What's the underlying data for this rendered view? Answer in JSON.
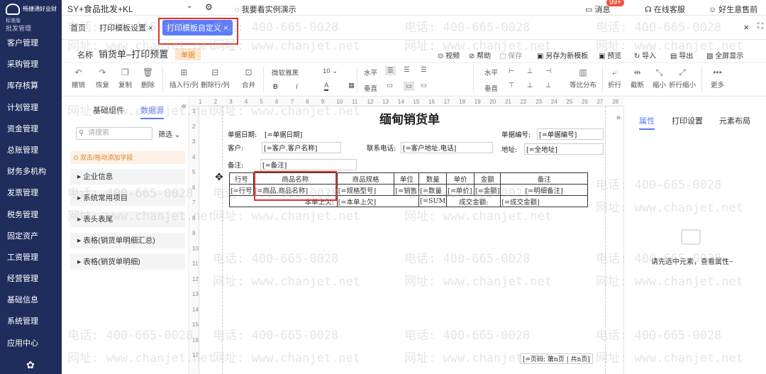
{
  "app": {
    "logo_text": "畅捷通好业财",
    "edition": "标准版",
    "module": "批发管理",
    "company": "SY+食品批发+KL",
    "demo_link": "我要看实例演示",
    "messages_label": "消息",
    "messages_count": "99+",
    "service_label": "在线客服",
    "user_label": "好生意售前"
  },
  "sidebar": {
    "items": [
      "客户管理",
      "采购管理",
      "库存核算",
      "计划管理",
      "资金管理",
      "总账管理",
      "财务多机构",
      "发票管理",
      "税务管理",
      "固定资产",
      "工资管理",
      "经营管理",
      "基础信息",
      "系统管理",
      "应用中心"
    ]
  },
  "tabs": [
    {
      "label": "首页"
    },
    {
      "label": "打印模板设置"
    },
    {
      "label": "打印模板自定义"
    }
  ],
  "template": {
    "name_label": "名称",
    "name": "销货单–打印预置",
    "tag": "单据",
    "actions": [
      "视频",
      "帮助",
      "保存",
      "另存为新模板",
      "预览",
      "导入",
      "导出",
      "全屏显示"
    ]
  },
  "toolbar": {
    "undo": "撤销",
    "redo": "恢复",
    "copy": "复制",
    "delete": "删除",
    "insert_row": "插入行/列",
    "delete_row": "删除行/列",
    "merge": "合并",
    "font": "微软雅黑",
    "size": "10",
    "h_align": "水平",
    "v_align": "垂直",
    "h_align2": "水平",
    "v_align2": "垂直",
    "dist": "等比分布",
    "wrap": "折行",
    "cut": "截断",
    "shrink": "缩小",
    "wrap_shrink": "折行缩小",
    "more": "更多"
  },
  "left_panel": {
    "tab_basic": "基础组件",
    "tab_data": "数据源",
    "search_placeholder": "请搜索",
    "filter": "筛选",
    "hint": "双击/拖动添加字段",
    "groups": [
      "企业信息",
      "系统常用项目",
      "表头表尾",
      "表格(销货单明细汇总)",
      "表格(销货单明细)"
    ]
  },
  "report": {
    "title": "缅甸销货单",
    "date_label": "单据日期:",
    "date_val": "[=单据日期]",
    "no_label": "单据编号:",
    "no_val": "[=单据编号]",
    "cust_label": "客户:",
    "cust_val": "[=客户.客户名称]",
    "tel_label": "联系电话:",
    "tel_val": "[=客户地址.电话]",
    "addr_label": "地址:",
    "addr_val": "[=全地址]",
    "note_label": "备注:",
    "note_val": "[=备注]",
    "headers": [
      "行号",
      "商品名称",
      "商品规格",
      "单位",
      "数量",
      "单价",
      "金额",
      "备注"
    ],
    "row": [
      "[=行号",
      "[=商品.商品名称]",
      "[=规格型号]",
      "[=销售",
      "[=数量",
      "[=单价]",
      "[=金额]",
      "[=明细备注]"
    ],
    "owe_label": "本单上欠:",
    "owe_val": "[=本单上欠]",
    "sum_val": "[=SUM",
    "deal_label": "成交金额:",
    "deal_val": "[=成交金额]",
    "page": "[=页码: 第n页 | 共n页]"
  },
  "right_panel": {
    "tabs": [
      "属性",
      "打印设置",
      "元素布局"
    ],
    "empty": "请先选中元素，查看属性~"
  },
  "watermark": {
    "phone": "电话: 400-665-0028",
    "site": "网址: www.chanjet.net"
  },
  "colors": {
    "sidebar": "#1f2d5c",
    "accent": "#5b7bfa",
    "highlight": "#d9342b"
  }
}
